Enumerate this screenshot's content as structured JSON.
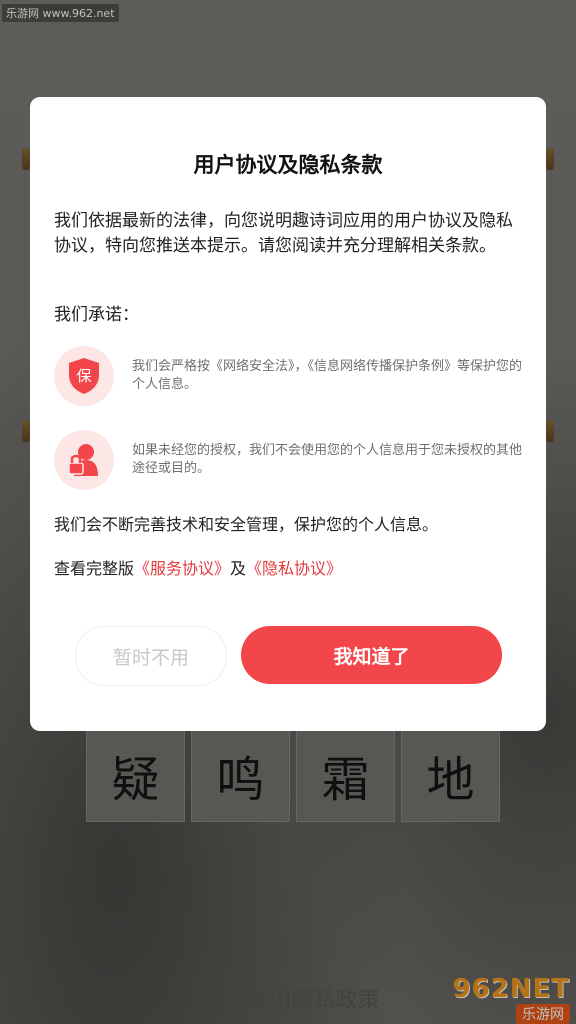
{
  "watermark_top": "乐游网 www.962.net",
  "background": {
    "chars": [
      "疑",
      "鸣",
      "霜",
      "地"
    ],
    "bottom_links": "服务协议|隐私政策",
    "logo_big": "962NET",
    "logo_small": "乐游网"
  },
  "modal": {
    "title": "用户协议及隐私条款",
    "intro": "我们依据最新的法律，向您说明趣诗词应用的用户协议及隐私协议，特向您推送本提示。请您阅读并充分理解相关条款。",
    "promise_label": "我们承诺：",
    "items": [
      {
        "icon": "shield-icon",
        "icon_text": "保",
        "text": "我们会严格按《网络安全法》，《信息网络传播保护条例》等保护您的个人信息。"
      },
      {
        "icon": "user-lock-icon",
        "text": "如果未经您的授权，我们不会使用您的个人信息用于您未授权的其他途径或目的。"
      }
    ],
    "commitment": "我们会不断完善技术和安全管理，保护您的个人信息。",
    "links": {
      "prefix": "查看完整版",
      "service": "《服务协议》",
      "and": "及",
      "privacy": "《隐私协议》"
    },
    "buttons": {
      "later": "暂时不用",
      "ok": "我知道了"
    }
  },
  "colors": {
    "accent": "#f2464a",
    "link": "#e23b3b",
    "icon_bg": "#fde7e6"
  }
}
